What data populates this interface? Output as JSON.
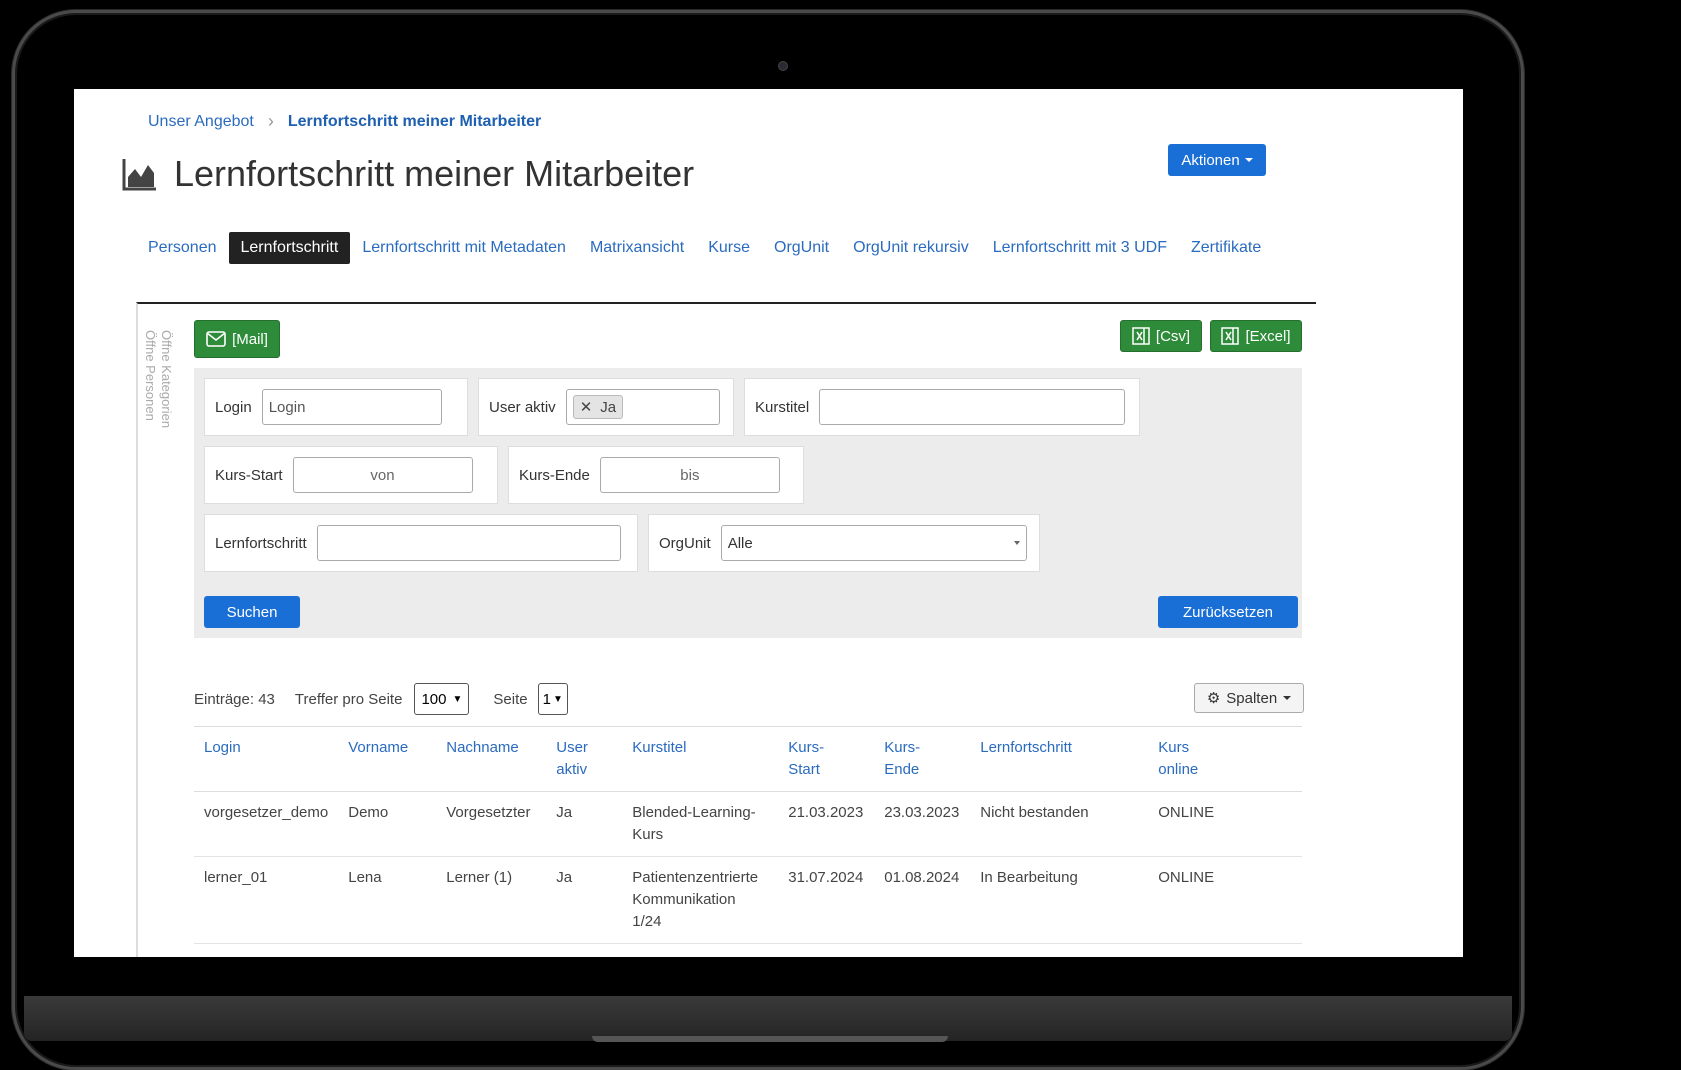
{
  "breadcrumb": {
    "parent": "Unser Angebot",
    "current": "Lernfortschritt meiner Mitarbeiter"
  },
  "page": {
    "title": "Lernfortschritt meiner Mitarbeiter"
  },
  "actions": {
    "label": "Aktionen"
  },
  "tabs": [
    {
      "label": "Personen"
    },
    {
      "label": "Lernfortschritt"
    },
    {
      "label": "Lernfortschritt mit Metadaten"
    },
    {
      "label": "Matrixansicht"
    },
    {
      "label": "Kurse"
    },
    {
      "label": "OrgUnit"
    },
    {
      "label": "OrgUnit rekursiv"
    },
    {
      "label": "Lernfortschritt mit 3 UDF"
    },
    {
      "label": "Zertifikate"
    }
  ],
  "side_labels": {
    "categories": "Öffne Kategorien",
    "persons": "Öffne Personen"
  },
  "toolbar": {
    "mail": "[Mail]",
    "csv": "[Csv]",
    "excel": "[Excel]"
  },
  "filters": {
    "login": {
      "label": "Login",
      "placeholder": "Login"
    },
    "user_aktiv": {
      "label": "User aktiv",
      "tag": "Ja"
    },
    "kurstitel": {
      "label": "Kurstitel",
      "value": ""
    },
    "kurs_start": {
      "label": "Kurs-Start",
      "placeholder": "von"
    },
    "kurs_ende": {
      "label": "Kurs-Ende",
      "placeholder": "bis"
    },
    "lernfortschritt": {
      "label": "Lernfortschritt",
      "value": ""
    },
    "orgunit": {
      "label": "OrgUnit",
      "value": "Alle"
    },
    "search": "Suchen",
    "reset": "Zurücksetzen"
  },
  "table_controls": {
    "entries": "Einträge: 43",
    "per_page_label": "Treffer pro Seite",
    "per_page_value": "100",
    "page_label": "Seite",
    "page_value": "1",
    "columns_button": "Spalten"
  },
  "table": {
    "headers": [
      [
        "Login"
      ],
      [
        "Vorname"
      ],
      [
        "Nachname"
      ],
      [
        "User",
        "aktiv"
      ],
      [
        "Kurstitel"
      ],
      [
        "Kurs-",
        "Start"
      ],
      [
        "Kurs-",
        "Ende"
      ],
      [
        "Lernfortschritt"
      ],
      [
        "Kurs",
        "online"
      ]
    ],
    "rows": [
      [
        "vorgesetzer_demo",
        "Demo",
        "Vorgesetzter",
        "Ja",
        "Blended-Learning-Kurs",
        "21.03.2023",
        "23.03.2023",
        "Nicht bestanden",
        "ONLINE"
      ],
      [
        "lerner_01",
        "Lena",
        "Lerner (1)",
        "Ja",
        "Patientenzentrierte Kommunikation 1/24",
        "31.07.2024",
        "01.08.2024",
        "In Bearbeitung",
        "ONLINE"
      ]
    ]
  },
  "colors": {
    "link": "#2a6bbf",
    "primary": "#1a6fd6",
    "success": "#2e8b3a",
    "tab_active": "#222222"
  }
}
